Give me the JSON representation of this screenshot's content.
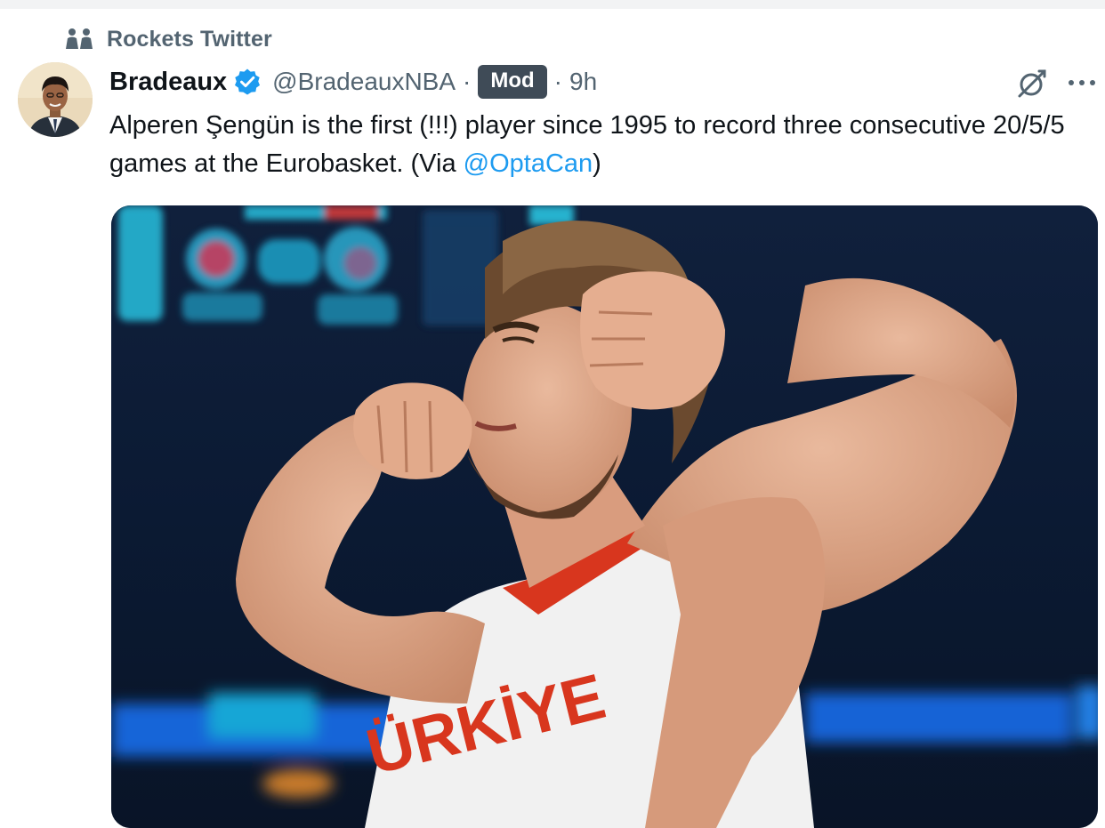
{
  "community": {
    "name": "Rockets Twitter",
    "icon": "community-icon"
  },
  "post": {
    "author_name": "Bradeaux",
    "verified": true,
    "handle": "@BradeauxNBA",
    "separator": "·",
    "badge": "Mod",
    "time": "9h",
    "text_main": "Alperen Şengün is the first (!!!) player since 1995 to record three consecutive 20/5/5 games at the Eurobasket. (Via ",
    "mention": "@OptaCan",
    "text_end": ")",
    "jersey_text": "ÜRKİYE"
  },
  "actions": {
    "grok_icon": "grok-icon",
    "more_icon": "more-icon"
  },
  "colors": {
    "link": "#1d9bf0",
    "verified": "#1d9bf0",
    "secondary_text": "#536471",
    "mod_badge_bg": "#3f4b57",
    "jersey_red": "#d8361e"
  }
}
